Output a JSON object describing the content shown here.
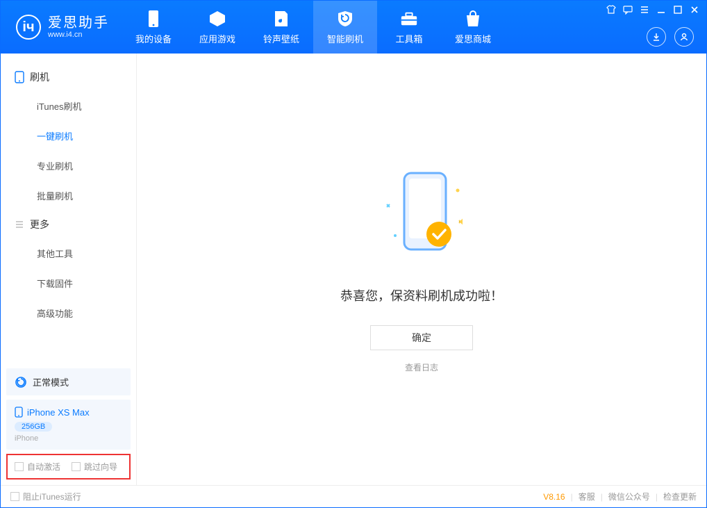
{
  "app": {
    "name": "爱思助手",
    "url": "www.i4.cn"
  },
  "nav": [
    {
      "label": "我的设备"
    },
    {
      "label": "应用游戏"
    },
    {
      "label": "铃声壁纸"
    },
    {
      "label": "智能刷机",
      "active": true
    },
    {
      "label": "工具箱"
    },
    {
      "label": "爱思商城"
    }
  ],
  "sidebar": {
    "sections": [
      {
        "title": "刷机",
        "items": [
          "iTunes刷机",
          "一键刷机",
          "专业刷机",
          "批量刷机"
        ],
        "activeIndex": 1
      },
      {
        "title": "更多",
        "items": [
          "其他工具",
          "下载固件",
          "高级功能"
        ],
        "activeIndex": -1
      }
    ],
    "status": "正常模式",
    "device": {
      "name": "iPhone XS Max",
      "storage": "256GB",
      "type": "iPhone"
    },
    "checks": {
      "autoActivate": "自动激活",
      "skipGuide": "跳过向导"
    }
  },
  "main": {
    "message": "恭喜您，保资料刷机成功啦！",
    "okLabel": "确定",
    "logLabel": "查看日志"
  },
  "footer": {
    "blockItunes": "阻止iTunes运行",
    "version": "V8.16",
    "links": [
      "客服",
      "微信公众号",
      "检查更新"
    ]
  }
}
